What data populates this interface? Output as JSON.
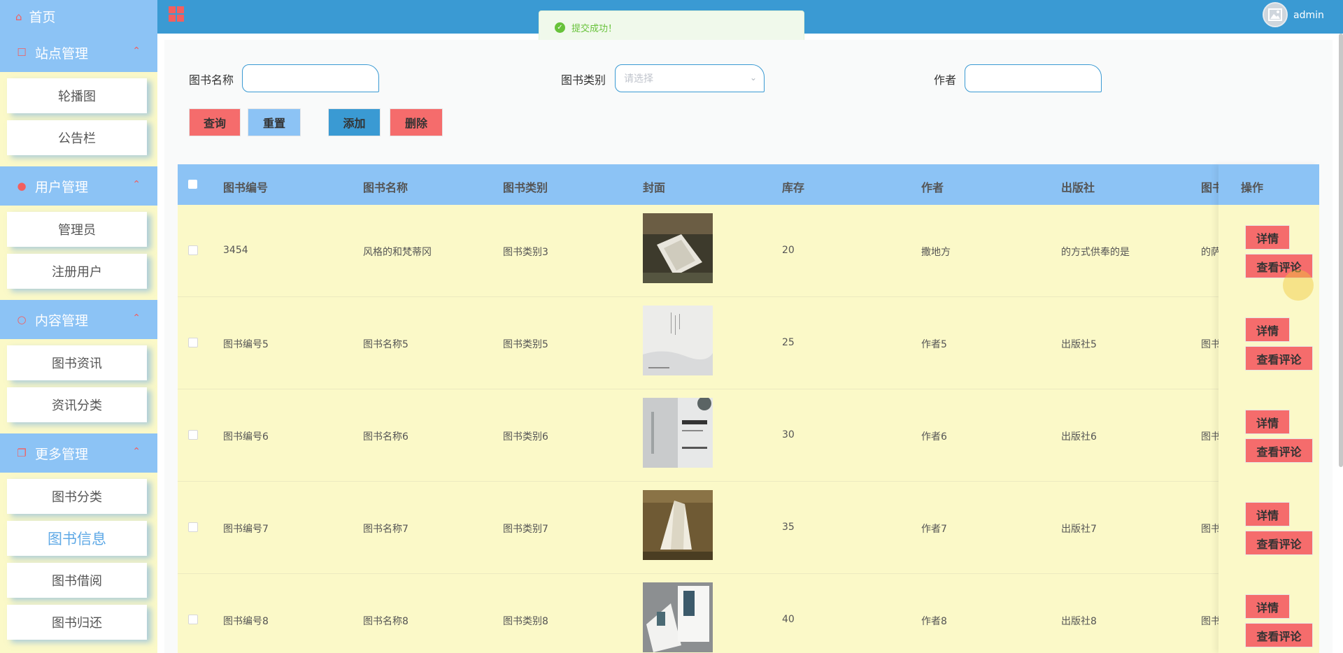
{
  "sidebar": {
    "home": "首页",
    "groups": [
      {
        "label": "站点管理",
        "items": [
          "轮播图",
          "公告栏"
        ]
      },
      {
        "label": "用户管理",
        "items": [
          "管理员",
          "注册用户"
        ]
      },
      {
        "label": "内容管理",
        "items": [
          "图书资讯",
          "资讯分类"
        ]
      },
      {
        "label": "更多管理",
        "items": [
          "图书分类",
          "图书信息",
          "图书借阅",
          "图书归还"
        ]
      }
    ]
  },
  "header": {
    "user": "admin"
  },
  "toast": {
    "message": "提交成功！"
  },
  "search": {
    "book_name_label": "图书名称",
    "book_name_value": "",
    "category_label": "图书类别",
    "category_placeholder": "请选择",
    "author_label": "作者",
    "author_value": ""
  },
  "buttons": {
    "query": "查询",
    "reset": "重置",
    "add": "添加",
    "delete": "删除"
  },
  "table": {
    "headers": [
      "图书编号",
      "图书名称",
      "图书类别",
      "封面",
      "库存",
      "作者",
      "出版社",
      "图书介",
      "操作"
    ],
    "rows": [
      {
        "id": "3454",
        "name": "风格的和梵蒂冈",
        "category": "图书类别3",
        "stock": "20",
        "author": "撒地方",
        "publisher": "的方式供奉的是",
        "intro": "的萨芬"
      },
      {
        "id": "图书编号5",
        "name": "图书名称5",
        "category": "图书类别5",
        "stock": "25",
        "author": "作者5",
        "publisher": "出版社5",
        "intro": "图书介"
      },
      {
        "id": "图书编号6",
        "name": "图书名称6",
        "category": "图书类别6",
        "stock": "30",
        "author": "作者6",
        "publisher": "出版社6",
        "intro": "图书介"
      },
      {
        "id": "图书编号7",
        "name": "图书名称7",
        "category": "图书类别7",
        "stock": "35",
        "author": "作者7",
        "publisher": "出版社7",
        "intro": "图书介"
      },
      {
        "id": "图书编号8",
        "name": "图书名称8",
        "category": "图书类别8",
        "stock": "40",
        "author": "作者8",
        "publisher": "出版社8",
        "intro": "图书介"
      }
    ],
    "row_actions": {
      "detail": "详情",
      "comments": "查看评论"
    }
  },
  "colors": {
    "sidebar_bg": "#fbf9c8",
    "sidebar_group": "#8cc3f5",
    "header": "#3a9ad3",
    "accent_red": "#f56c6c",
    "table_head": "#8cc3f5",
    "row_bg": "#fbf9c8"
  }
}
